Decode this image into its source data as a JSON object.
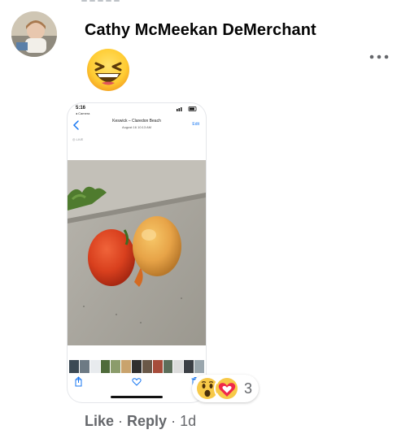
{
  "comment": {
    "author_name": "Cathy McMeekan DeMerchant",
    "emoji": "grinning-squinting-face",
    "more_icon": "more-dots-icon"
  },
  "screenshot": {
    "status_time": "5:16",
    "status_app": "◂ Camera",
    "title": "Keswick – Claredon Beach",
    "subtitle": "August 16 10:13 AM",
    "edit_label": "Edit",
    "live_label": "◎ LIVE",
    "photo_subject": "two tomatoes on pavement",
    "toolbar_icons": [
      "share-icon",
      "heart-icon",
      "trash-icon"
    ]
  },
  "reactions": {
    "icons": [
      "wow-icon",
      "care-icon"
    ],
    "count": "3"
  },
  "actions": {
    "like_label": "Like",
    "reply_label": "Reply",
    "separator": "·",
    "timestamp": "1d"
  },
  "colors": {
    "name_text": "#050505",
    "secondary_text": "#65676b",
    "link_blue": "#1877f2"
  }
}
